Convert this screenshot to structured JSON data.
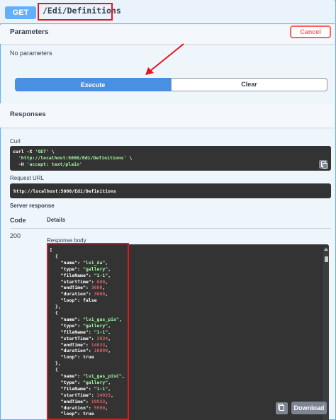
{
  "summary": {
    "method": "GET",
    "path": "/Edi/Definitions"
  },
  "parameters": {
    "title": "Parameters",
    "cancel_label": "Cancel",
    "empty_text": "No parameters"
  },
  "actions": {
    "execute_label": "Execute",
    "clear_label": "Clear"
  },
  "responses": {
    "title": "Responses",
    "curl_label": "Curl",
    "curl_lines": [
      [
        "curl -X ",
        "'GET'",
        " \\"
      ],
      [
        "  ",
        "'http://localhost:5000/Edi/Definitions'",
        " \\"
      ],
      [
        "  -H ",
        "'accept: text/plain'",
        ""
      ]
    ],
    "request_url_label": "Request URL",
    "request_url": "http://localhost:5000/Edi/Definitions",
    "server_response_label": "Server response",
    "code_header": "Code",
    "details_header": "Details",
    "code": "200",
    "response_body_label": "Response body",
    "download_label": "Download",
    "body_lines": [
      {
        "t": "["
      },
      {
        "t": "  {"
      },
      {
        "k": "name",
        "v": "\"lv1_Aa\"",
        "vt": "str"
      },
      {
        "k": "type",
        "v": "\"gallery\"",
        "vt": "str"
      },
      {
        "k": "fileName",
        "v": "\"1-1\"",
        "vt": "str"
      },
      {
        "k": "startTime",
        "v": "680",
        "vt": "num"
      },
      {
        "k": "endTime",
        "v": "3680",
        "vt": "num"
      },
      {
        "k": "duration",
        "v": "3000",
        "vt": "num"
      },
      {
        "k": "loop",
        "v": "false",
        "vt": "bool",
        "last": true
      },
      {
        "t": "  },"
      },
      {
        "t": "  {"
      },
      {
        "k": "name",
        "v": "\"lv1_gas_pis\"",
        "vt": "str"
      },
      {
        "k": "type",
        "v": "\"gallery\"",
        "vt": "str"
      },
      {
        "k": "fileName",
        "v": "\"1-1\"",
        "vt": "str"
      },
      {
        "k": "startTime",
        "v": "3934",
        "vt": "num"
      },
      {
        "k": "endTime",
        "v": "14033",
        "vt": "num"
      },
      {
        "k": "duration",
        "v": "10099",
        "vt": "num"
      },
      {
        "k": "loop",
        "v": "true",
        "vt": "bool",
        "last": true
      },
      {
        "t": "  },"
      },
      {
        "t": "  {"
      },
      {
        "k": "name",
        "v": "\"lv1_gas_pisC\"",
        "vt": "str"
      },
      {
        "k": "type",
        "v": "\"gallery\"",
        "vt": "str"
      },
      {
        "k": "fileName",
        "v": "\"1-1\"",
        "vt": "str"
      },
      {
        "k": "startTime",
        "v": "14033",
        "vt": "num"
      },
      {
        "k": "endTime",
        "v": "19933",
        "vt": "num"
      },
      {
        "k": "duration",
        "v": "5900",
        "vt": "num"
      },
      {
        "k": "loop",
        "v": "true",
        "vt": "bool",
        "last": true
      }
    ]
  },
  "colors": {
    "accent": "#61affe",
    "execute": "#4990e2",
    "cancel": "#ff6060",
    "annotation": "#e8151b",
    "code_bg": "#333333",
    "string": "#a2fca2",
    "number": "#d36363"
  }
}
